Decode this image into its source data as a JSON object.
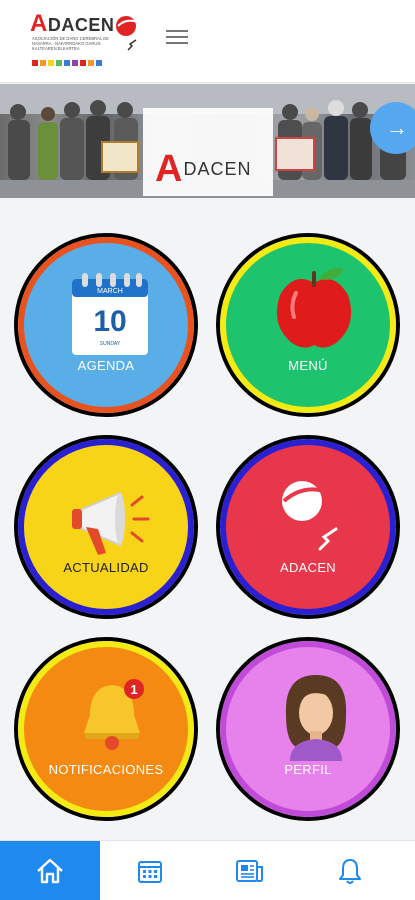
{
  "header": {
    "logo_word_prefix": "A",
    "logo_word_rest": "DACEN",
    "logo_subtitle": "Asociación de daño cerebral de Navarra · Nafarroako garun kaltearen elkartea"
  },
  "banner": {
    "title_prefix": "A",
    "title_rest": "DACEN"
  },
  "tiles": [
    {
      "label": "AGENDA",
      "fill": "#5aaee8",
      "ring": "#e8521f",
      "icon": "calendar-icon",
      "calendar_month": "MARCH",
      "calendar_day": "10",
      "calendar_weekday": "SUNDAY"
    },
    {
      "label": "MENÚ",
      "fill": "#1ec36e",
      "ring": "#f4ea14",
      "icon": "apple-icon"
    },
    {
      "label": "ACTUALIDAD",
      "fill": "#f7d417",
      "ring": "#2a1fd1",
      "icon": "megaphone-icon"
    },
    {
      "label": "ADACEN",
      "fill": "#e8374a",
      "ring": "#2a1fd1",
      "icon": "adacen-logo-icon"
    },
    {
      "label": "NOTIFICACIONES",
      "fill": "#f58a12",
      "ring": "#f4ea14",
      "icon": "bell-icon",
      "badge": "1"
    },
    {
      "label": "PERFIL",
      "fill": "#e782ec",
      "ring": "#c04bd8",
      "icon": "profile-avatar-icon"
    }
  ],
  "bottom_nav": [
    {
      "icon": "home-icon",
      "active": true
    },
    {
      "icon": "calendar-grid-icon",
      "active": false
    },
    {
      "icon": "news-icon",
      "active": false
    },
    {
      "icon": "bell-icon",
      "active": false
    }
  ],
  "colors": {
    "accent": "#1e8af0",
    "logo_red": "#e02424",
    "next_button": "#55a8f0"
  }
}
